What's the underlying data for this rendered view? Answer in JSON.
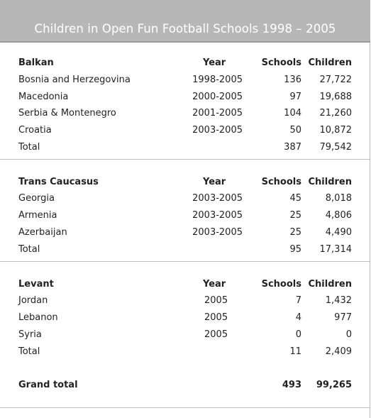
{
  "title": "Children in Open Fun Football Schools 1998 – 2005",
  "columns": {
    "year": "Year",
    "schools": "Schools",
    "children": "Children"
  },
  "sections": [
    {
      "name": "Balkan",
      "rows": [
        {
          "name": "Bosnia and Herzegovina",
          "year": "1998-2005",
          "schools": "136",
          "children": "27,722"
        },
        {
          "name": "Macedonia",
          "year": "2000-2005",
          "schools": "97",
          "children": "19,688"
        },
        {
          "name": "Serbia & Montenegro",
          "year": "2001-2005",
          "schools": "104",
          "children": "21,260"
        },
        {
          "name": "Croatia",
          "year": "2003-2005",
          "schools": "50",
          "children": "10,872"
        }
      ],
      "total": {
        "label": "Total",
        "schools": "387",
        "children": "79,542"
      }
    },
    {
      "name": "Trans Caucasus",
      "rows": [
        {
          "name": "Georgia",
          "year": "2003-2005",
          "schools": "45",
          "children": "8,018"
        },
        {
          "name": "Armenia",
          "year": "2003-2005",
          "schools": "25",
          "children": "4,806"
        },
        {
          "name": "Azerbaijan",
          "year": "2003-2005",
          "schools": "25",
          "children": "4,490"
        }
      ],
      "total": {
        "label": "Total",
        "schools": "95",
        "children": "17,314"
      }
    },
    {
      "name": "Levant",
      "rows": [
        {
          "name": "Jordan",
          "year": "2005",
          "schools": "7",
          "children": "1,432"
        },
        {
          "name": "Lebanon",
          "year": "2005",
          "schools": "4",
          "children": "977"
        },
        {
          "name": "Syria",
          "year": "2005",
          "schools": "0",
          "children": "0"
        }
      ],
      "total": {
        "label": "Total",
        "schools": "11",
        "children": "2,409"
      }
    }
  ],
  "grand_total": {
    "label": "Grand total",
    "schools": "493",
    "children": "99,265"
  }
}
